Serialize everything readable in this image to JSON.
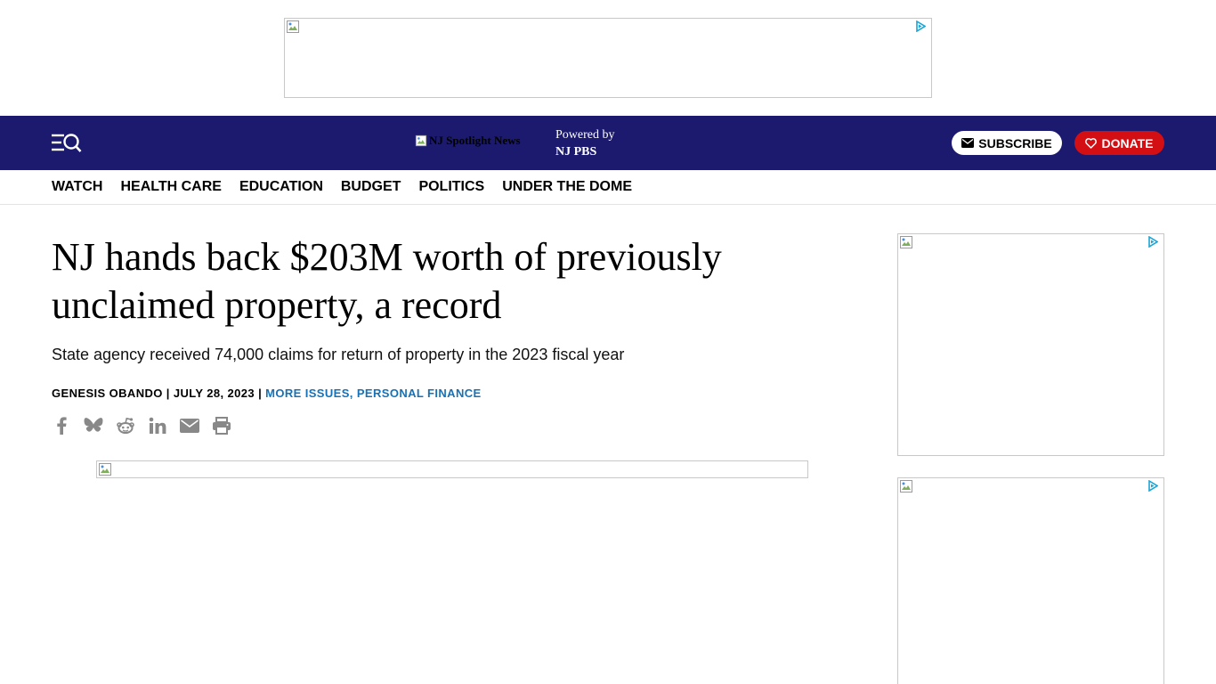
{
  "masthead": {
    "logo_alt": "NJ Spotlight News",
    "powered_by_line1": "Powered by",
    "powered_by_line2": "NJ PBS",
    "subscribe_label": "SUBSCRIBE",
    "donate_label": "DONATE",
    "colors": {
      "bar": "#1b1a6f",
      "donate": "#d40f14",
      "link": "#1672b8"
    }
  },
  "nav": {
    "items": [
      "WATCH",
      "HEALTH CARE",
      "EDUCATION",
      "BUDGET",
      "POLITICS",
      "UNDER THE DOME"
    ]
  },
  "article": {
    "headline": "NJ hands back $203M worth of previously unclaimed property, a record",
    "dek": "State agency received 74,000 claims for return of property in the 2023 fiscal year",
    "author": "GENESIS OBANDO",
    "separator": "|",
    "date": "JULY 28, 2023",
    "categories": "MORE ISSUES, PERSONAL FINANCE"
  },
  "share_icons": [
    "facebook-icon",
    "bluesky-icon",
    "reddit-icon",
    "linkedin-icon",
    "email-icon",
    "print-icon"
  ]
}
